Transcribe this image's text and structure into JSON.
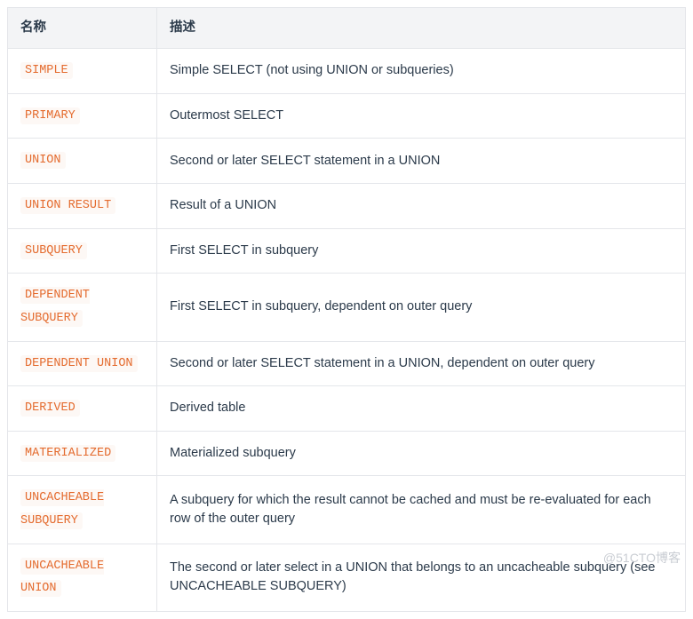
{
  "table": {
    "headers": {
      "name": "名称",
      "desc": "描述"
    },
    "rows": [
      {
        "name": "SIMPLE",
        "desc": "Simple SELECT (not using UNION or subqueries)"
      },
      {
        "name": "PRIMARY",
        "desc": "Outermost SELECT"
      },
      {
        "name": "UNION",
        "desc": "Second or later SELECT statement in a UNION"
      },
      {
        "name": "UNION RESULT",
        "desc": "Result of a UNION"
      },
      {
        "name": "SUBQUERY",
        "desc": "First SELECT in subquery"
      },
      {
        "name": "DEPENDENT SUBQUERY",
        "desc": "First SELECT in subquery, dependent on outer query"
      },
      {
        "name": "DEPENDENT UNION",
        "desc": "Second or later SELECT statement in a UNION, dependent on outer query"
      },
      {
        "name": "DERIVED",
        "desc": "Derived table"
      },
      {
        "name": "MATERIALIZED",
        "desc": "Materialized subquery"
      },
      {
        "name": "UNCACHEABLE SUBQUERY",
        "desc": "A subquery for which the result cannot be cached and must be re-evaluated for each row of the outer query"
      },
      {
        "name": "UNCACHEABLE UNION",
        "desc": "The second or later select in a UNION that belongs to an uncacheable subquery (see UNCACHEABLE SUBQUERY)"
      }
    ]
  },
  "watermark": "@51CTO博客"
}
